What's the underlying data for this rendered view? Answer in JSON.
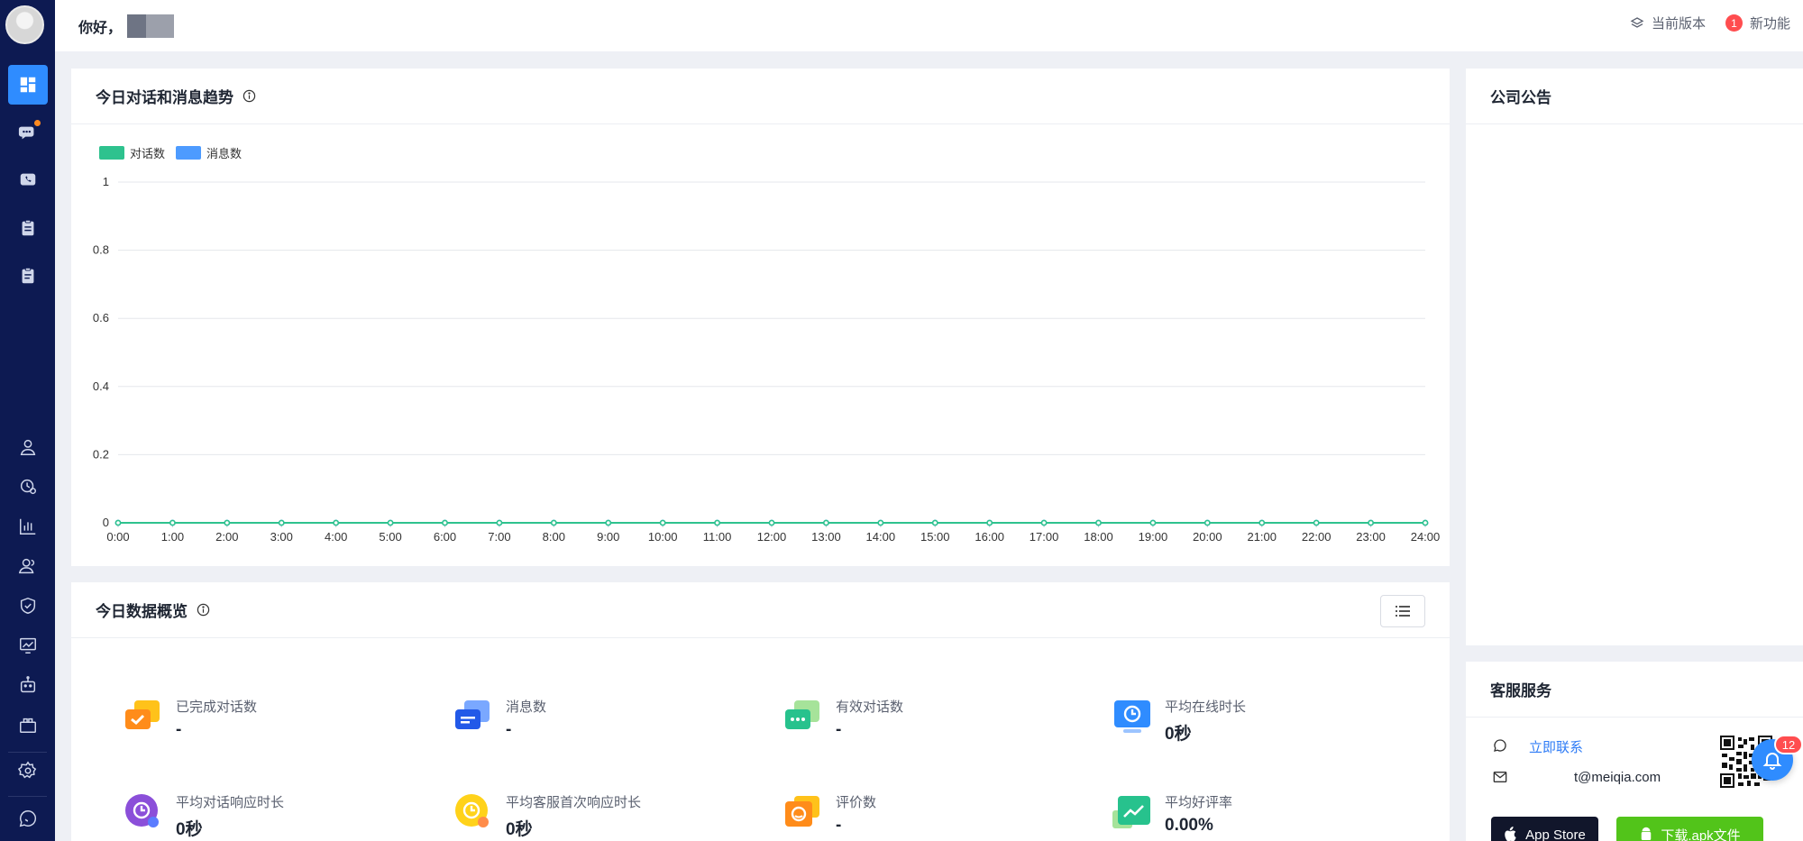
{
  "topbar": {
    "greeting": "你好，",
    "version_label": "当前版本",
    "new_feature_badge": "1",
    "new_feature_label": "新功能"
  },
  "trend_card": {
    "title": "今日对话和消息趋势",
    "legend": [
      {
        "name": "对话数",
        "color": "#2ec28e"
      },
      {
        "name": "消息数",
        "color": "#4d9bff"
      }
    ]
  },
  "chart_data": {
    "type": "line",
    "title": "今日对话和消息趋势",
    "x": [
      "0:00",
      "1:00",
      "2:00",
      "3:00",
      "4:00",
      "5:00",
      "6:00",
      "7:00",
      "8:00",
      "9:00",
      "10:00",
      "11:00",
      "12:00",
      "13:00",
      "14:00",
      "15:00",
      "16:00",
      "17:00",
      "18:00",
      "19:00",
      "20:00",
      "21:00",
      "22:00",
      "23:00",
      "24:00"
    ],
    "ylim": [
      0,
      1
    ],
    "yticks": [
      "0",
      "0.2",
      "0.4",
      "0.6",
      "0.8",
      "1"
    ],
    "grid": true,
    "legend_position": "top-left",
    "series": [
      {
        "name": "对话数",
        "color": "#2ec28e",
        "values": [
          0,
          0,
          0,
          0,
          0,
          0,
          0,
          0,
          0,
          0,
          0,
          0,
          0,
          0,
          0,
          0,
          0,
          0,
          0,
          0,
          0,
          0,
          0,
          0,
          0
        ]
      },
      {
        "name": "消息数",
        "color": "#4d9bff",
        "values": [
          0,
          0,
          0,
          0,
          0,
          0,
          0,
          0,
          0,
          0,
          0,
          0,
          0,
          0,
          0,
          0,
          0,
          0,
          0,
          0,
          0,
          0,
          0,
          0,
          0
        ]
      }
    ]
  },
  "overview_card": {
    "title": "今日数据概览",
    "stats": [
      {
        "label": "已完成对话数",
        "value": "-"
      },
      {
        "label": "消息数",
        "value": "-"
      },
      {
        "label": "有效对话数",
        "value": "-"
      },
      {
        "label": "平均在线时长",
        "value": "0秒"
      },
      {
        "label": "平均对话响应时长",
        "value": "0秒"
      },
      {
        "label": "平均客服首次响应时长",
        "value": "0秒"
      },
      {
        "label": "评价数",
        "value": "-"
      },
      {
        "label": "平均好评率",
        "value": "0.00%"
      }
    ]
  },
  "announcement_card": {
    "title": "公司公告"
  },
  "service_card": {
    "title": "客服服务",
    "contact_link": "立即联系",
    "email": "t@meiqia.com",
    "app_store_label": "App Store",
    "apk_label": "下载.apk文件"
  },
  "notification_count": "12"
}
